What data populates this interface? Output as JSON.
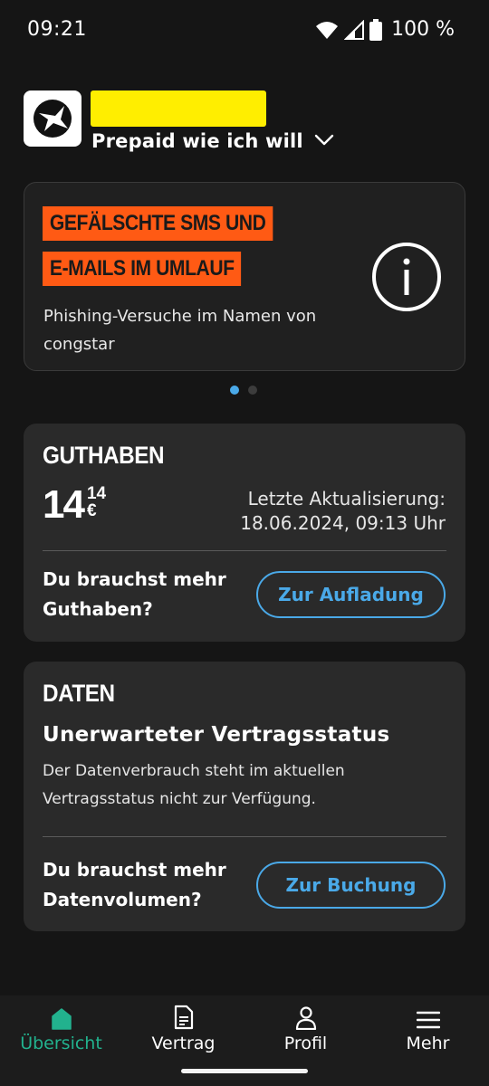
{
  "status_bar": {
    "time": "09:21",
    "battery": "100 %"
  },
  "header": {
    "tariff": "Prepaid wie ich will"
  },
  "banner": {
    "headline_line1": "GEFÄLSCHTE SMS UND",
    "headline_line2": "E-MAILS IM UMLAUF",
    "subtitle": "Phishing-Versuche im Namen von congstar",
    "pagination_total": 2,
    "pagination_active": 1
  },
  "guthaben": {
    "title": "GUTHABEN",
    "amount_euro": "14",
    "amount_cents": "14",
    "currency": "€",
    "update_label": "Letzte Aktualisierung:",
    "update_time": "18.06.2024, 09:13 Uhr",
    "cta_text": "Du brauchst mehr Guthaben?",
    "cta_button": "Zur Aufladung"
  },
  "daten": {
    "title": "DATEN",
    "subtitle": "Unerwarteter Vertragsstatus",
    "text": "Der Datenverbrauch steht im aktuellen Vertragsstatus nicht zur Verfügung.",
    "cta_text": "Du brauchst mehr Datenvolumen?",
    "cta_button": "Zur Buchung"
  },
  "bottom_nav": {
    "items": [
      {
        "label": "Übersicht",
        "icon": "home-icon",
        "active": true
      },
      {
        "label": "Vertrag",
        "icon": "document-icon",
        "active": false
      },
      {
        "label": "Profil",
        "icon": "person-icon",
        "active": false
      },
      {
        "label": "Mehr",
        "icon": "menu-icon",
        "active": false
      }
    ]
  },
  "colors": {
    "background": "#151515",
    "card": "#2a2a2a",
    "accent_blue": "#4aa9e8",
    "banner_orange": "#ff5a14",
    "redaction_yellow": "#ffee00",
    "nav_active": "#22b28e"
  }
}
